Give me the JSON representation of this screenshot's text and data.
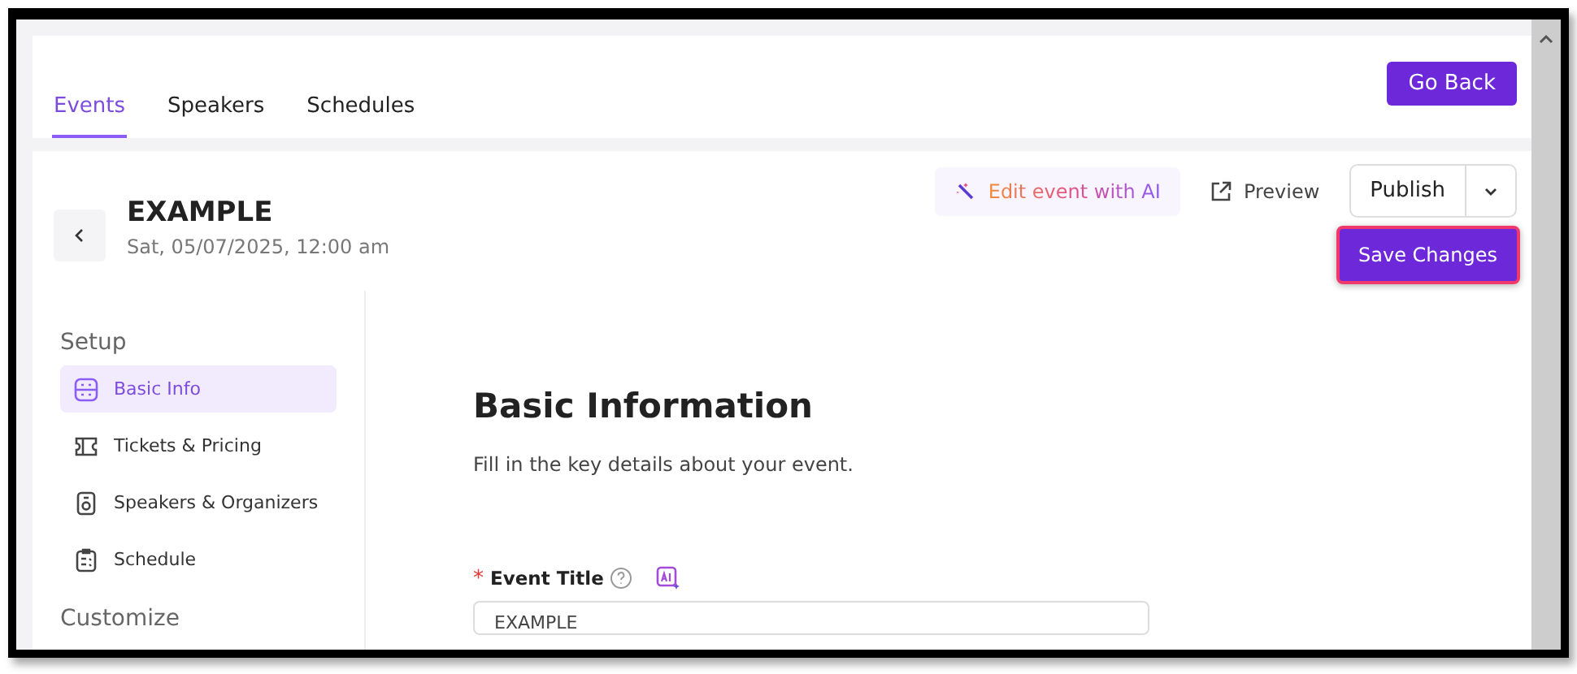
{
  "tabs": [
    {
      "label": "Events",
      "selected": true
    },
    {
      "label": "Speakers",
      "selected": false
    },
    {
      "label": "Schedules",
      "selected": false
    }
  ],
  "go_back": "Go Back",
  "event": {
    "title": "EXAMPLE",
    "date": "Sat, 05/07/2025, 12:00 am"
  },
  "actions": {
    "edit_ai": "Edit event with AI",
    "preview": "Preview",
    "publish": "Publish",
    "save": "Save Changes",
    "save_highlighted": true
  },
  "sidebar": [
    {
      "heading": "Setup",
      "items": [
        {
          "label": "Basic Info",
          "kind": "grid",
          "selected": true
        },
        {
          "label": "Tickets & Pricing",
          "kind": "ticket",
          "selected": false
        },
        {
          "label": "Speakers & Organizers",
          "kind": "badge",
          "selected": false
        },
        {
          "label": "Schedule",
          "kind": "clipboard",
          "selected": false
        }
      ]
    },
    {
      "heading": "Customize"
    }
  ],
  "form": {
    "heading": "Basic Information",
    "description": "Fill in the key details about your event.",
    "fields": [
      {
        "label": "Event Title",
        "required_mark": "*",
        "value": "EXAMPLE"
      }
    ]
  }
}
